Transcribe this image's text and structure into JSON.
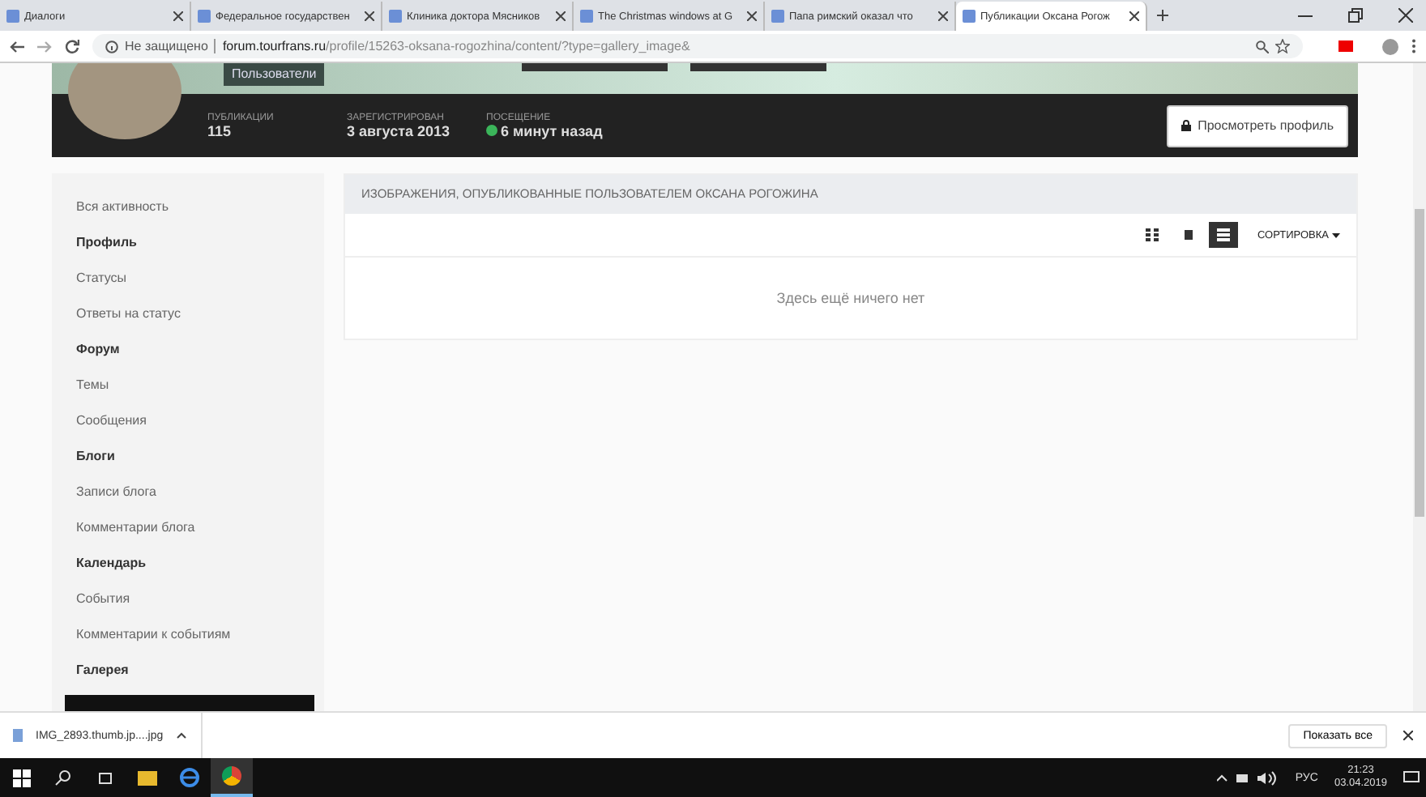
{
  "browser": {
    "tabs": [
      {
        "title": "Диалоги",
        "selected": false
      },
      {
        "title": "Федеральное государствен",
        "selected": false
      },
      {
        "title": "Клиника доктора Мясников",
        "selected": false
      },
      {
        "title": "The Christmas windows at G",
        "selected": false
      },
      {
        "title": "Папа римский оказал что",
        "selected": false
      },
      {
        "title": "Публикации Оксана Рогож",
        "selected": true
      }
    ],
    "security": "Не защищено",
    "domain": "forum.tourfrans.ru",
    "path": "/profile/15263-oksana-rogozhina/content/?type=gallery_image&"
  },
  "profile": {
    "group": "Пользователи",
    "stats": [
      {
        "label": "ПУБЛИКАЦИИ",
        "value": "115",
        "online": false
      },
      {
        "label": "ЗАРЕГИСТРИРОВАН",
        "value": "3 августа 2013",
        "online": false
      },
      {
        "label": "ПОСЕЩЕНИЕ",
        "value": "6 минут назад",
        "online": true
      }
    ],
    "view_button": "Просмотреть профиль"
  },
  "sidebar": {
    "items": [
      {
        "kind": "link",
        "label": "Вся активность"
      },
      {
        "kind": "heading",
        "label": "Профиль"
      },
      {
        "kind": "link",
        "label": "Статусы"
      },
      {
        "kind": "link",
        "label": "Ответы на статус"
      },
      {
        "kind": "heading",
        "label": "Форум"
      },
      {
        "kind": "link",
        "label": "Темы"
      },
      {
        "kind": "link",
        "label": "Сообщения"
      },
      {
        "kind": "heading",
        "label": "Блоги"
      },
      {
        "kind": "link",
        "label": "Записи блога"
      },
      {
        "kind": "link",
        "label": "Комментарии блога"
      },
      {
        "kind": "heading",
        "label": "Календарь"
      },
      {
        "kind": "link",
        "label": "События"
      },
      {
        "kind": "link",
        "label": "Комментарии к событиям"
      },
      {
        "kind": "heading",
        "label": "Галерея"
      },
      {
        "kind": "active"
      }
    ]
  },
  "content": {
    "title": "ИЗОБРАЖЕНИЯ, ОПУБЛИКОВАННЫЕ ПОЛЬЗОВАТЕЛЕМ ОКСАНА РОГОЖИНА",
    "views": [
      {
        "kind": "grid",
        "selected": false
      },
      {
        "kind": "single",
        "selected": false
      },
      {
        "kind": "list",
        "selected": true
      }
    ],
    "sort": "СОРТИРОВКА",
    "empty": "Здесь ещё ничего нет"
  },
  "downloads": {
    "file": "IMG_2893.thumb.jp....jpg",
    "show_all": "Показать все"
  },
  "taskbar": {
    "lang": "РУС",
    "time": "21:23",
    "date": "03.04.2019"
  }
}
